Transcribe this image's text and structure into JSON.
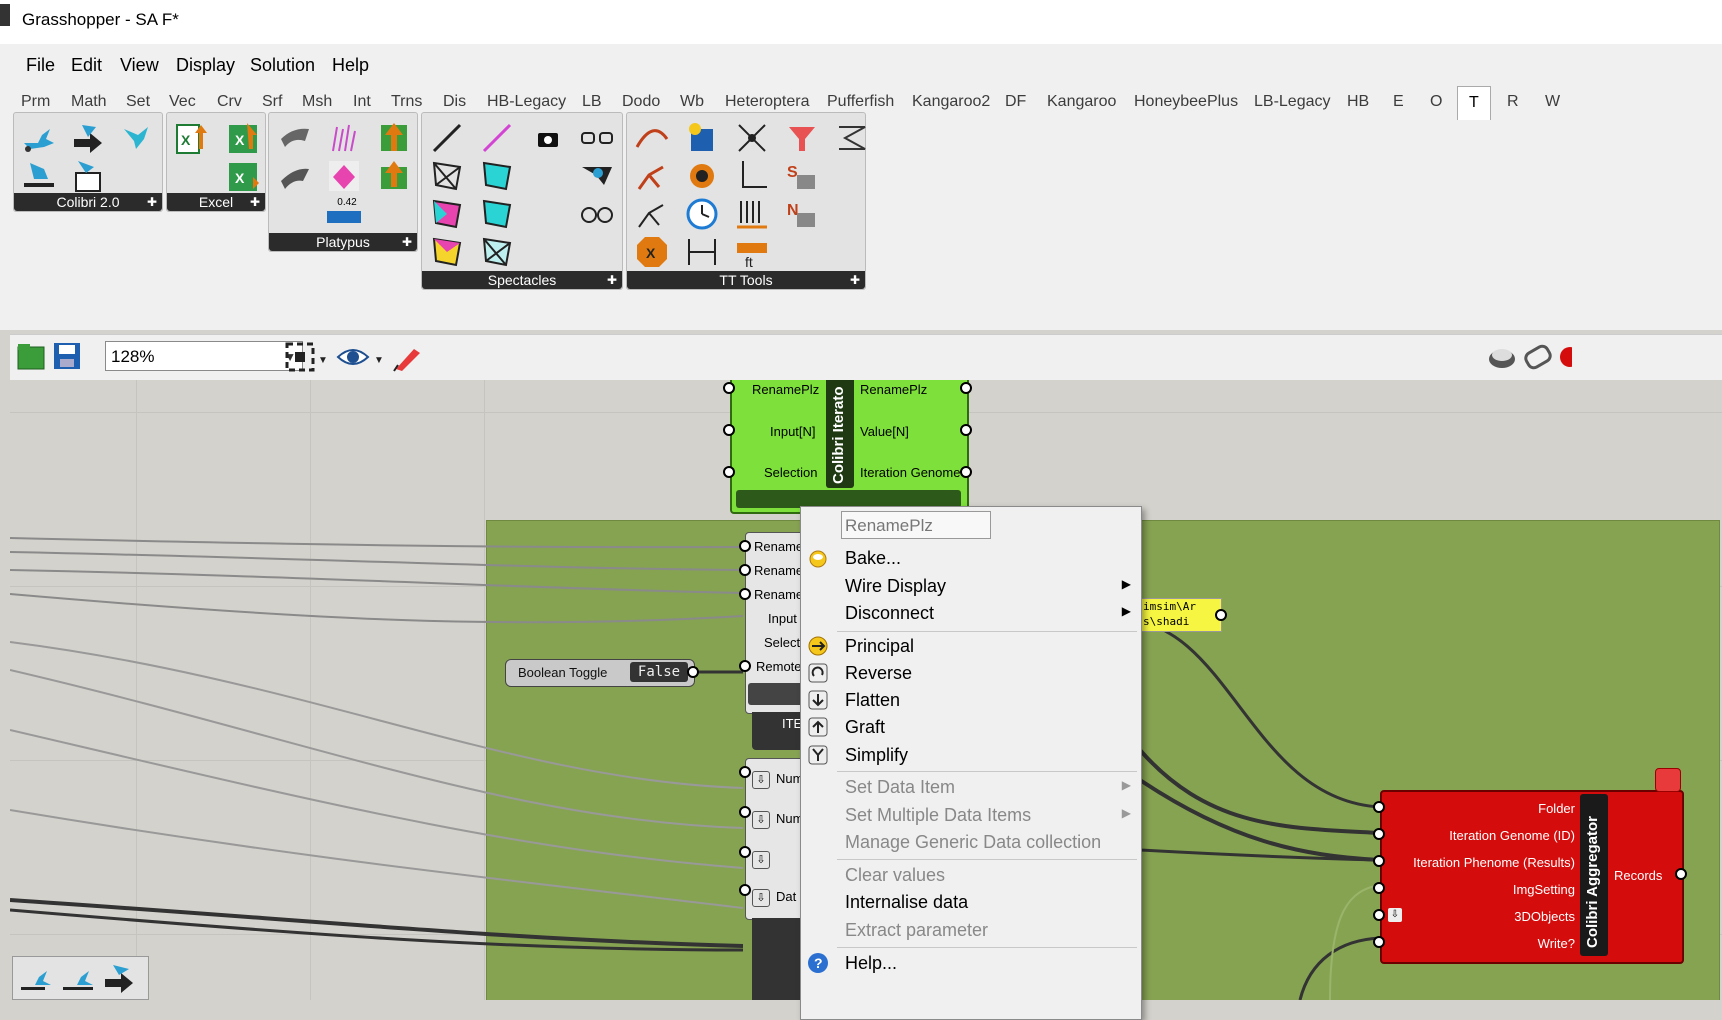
{
  "window": {
    "title": "Grasshopper - SA F*"
  },
  "menubar": {
    "items": [
      "File",
      "Edit",
      "View",
      "Display",
      "Solution",
      "Help"
    ]
  },
  "tabs": [
    "Prm",
    "Math",
    "Set",
    "Vec",
    "Crv",
    "Srf",
    "Msh",
    "Int",
    "Trns",
    "Dis",
    "HB-Legacy",
    "LB",
    "Dodo",
    "Wb",
    "Heteroptera",
    "Pufferfish",
    "Kangaroo2",
    "DF",
    "Kangaroo",
    "HoneybeePlus",
    "LB-Legacy",
    "HB",
    "E",
    "O",
    "T",
    "R",
    "W"
  ],
  "active_tab": "T",
  "ribbon": {
    "panels": [
      {
        "label": "Colibri 2.0"
      },
      {
        "label": "Excel"
      },
      {
        "label": "Platypus",
        "value_text": "0.42"
      },
      {
        "label": "Spectacles"
      },
      {
        "label": "TT Tools"
      }
    ]
  },
  "toolbar": {
    "zoom": "128%"
  },
  "components": {
    "iterator": {
      "title": "Colibri Iterato",
      "inputs": [
        "RenamePlz",
        "Input[N]",
        "Selection"
      ],
      "outputs": [
        "RenamePlz",
        "Value[N]",
        "Iteration Genome"
      ]
    },
    "inner": {
      "inputs": [
        "Rename",
        "Rename",
        "Rename",
        "Input",
        "Select",
        "Remote"
      ],
      "footer": "ITE"
    },
    "inner2": {
      "inputs": [
        "Num",
        "Num",
        "",
        "Dat"
      ]
    },
    "boolean_toggle": {
      "label": "Boolean Toggle",
      "value": "False"
    },
    "panel_text": {
      "line1": "imsim\\Ar",
      "line2": "s\\shadi"
    },
    "aggregator": {
      "title": "Colibri Aggregator",
      "inputs": [
        "Folder",
        "Iteration Genome (ID)",
        "Iteration Phenome (Results)",
        "ImgSetting",
        "3DObjects",
        "Write?"
      ],
      "outputs": [
        "Records"
      ]
    }
  },
  "context_menu": {
    "name_field": "RenamePlz",
    "items": [
      {
        "label": "Bake...",
        "icon": "bake-icon",
        "enabled": true,
        "submenu": false
      },
      {
        "label": "Wire Display",
        "icon": "",
        "enabled": true,
        "submenu": true
      },
      {
        "label": "Disconnect",
        "icon": "",
        "enabled": true,
        "submenu": true
      },
      {
        "label": "Principal",
        "icon": "principal-icon",
        "enabled": true,
        "submenu": false
      },
      {
        "label": "Reverse",
        "icon": "reverse-icon",
        "enabled": true,
        "submenu": false
      },
      {
        "label": "Flatten",
        "icon": "flatten-icon",
        "enabled": true,
        "submenu": false
      },
      {
        "label": "Graft",
        "icon": "graft-icon",
        "enabled": true,
        "submenu": false
      },
      {
        "label": "Simplify",
        "icon": "simplify-icon",
        "enabled": true,
        "submenu": false
      },
      {
        "label": "Set Data Item",
        "icon": "",
        "enabled": false,
        "submenu": true
      },
      {
        "label": "Set Multiple Data Items",
        "icon": "",
        "enabled": false,
        "submenu": true
      },
      {
        "label": "Manage Generic Data collection",
        "icon": "",
        "enabled": false,
        "submenu": false
      },
      {
        "label": "Clear values",
        "icon": "",
        "enabled": false,
        "submenu": false
      },
      {
        "label": "Internalise data",
        "icon": "",
        "enabled": true,
        "submenu": false
      },
      {
        "label": "Extract parameter",
        "icon": "",
        "enabled": false,
        "submenu": false
      },
      {
        "label": "Help...",
        "icon": "help-icon",
        "enabled": true,
        "submenu": false
      }
    ]
  },
  "colors": {
    "canvas": "#d4d2cc",
    "group": "#86a352",
    "iterator_green": "#7ee03a",
    "aggregator_red": "#d40c0c",
    "panel_yellow": "#f5f542"
  }
}
